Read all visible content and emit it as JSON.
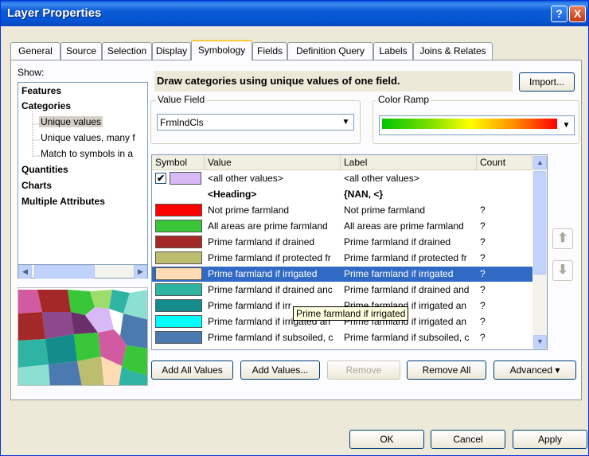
{
  "window": {
    "title": "Layer Properties",
    "help_glyph": "?",
    "close_glyph": "X"
  },
  "tabs": [
    {
      "label": "General"
    },
    {
      "label": "Source"
    },
    {
      "label": "Selection"
    },
    {
      "label": "Display"
    },
    {
      "label": "Symbology",
      "active": true
    },
    {
      "label": "Fields"
    },
    {
      "label": "Definition Query"
    },
    {
      "label": "Labels"
    },
    {
      "label": "Joins & Relates"
    }
  ],
  "show": {
    "label": "Show:",
    "items": [
      {
        "label": "Features"
      },
      {
        "label": "Categories"
      },
      {
        "label": "Unique values",
        "selected": true
      },
      {
        "label": "Unique values, many f"
      },
      {
        "label": "Match to symbols in a"
      },
      {
        "label": "Quantities"
      },
      {
        "label": "Charts"
      },
      {
        "label": "Multiple Attributes"
      }
    ]
  },
  "description": "Draw categories using unique values of one field.",
  "import_label": "Import...",
  "value_field": {
    "label": "Value Field",
    "value": "FrmlndCls"
  },
  "color_ramp": {
    "label": "Color Ramp",
    "colors": [
      "#00c400",
      "#ffff00",
      "#ff0000"
    ]
  },
  "table": {
    "headers": {
      "symbol": "Symbol",
      "value": "Value",
      "label": "Label",
      "count": "Count"
    },
    "rows": [
      {
        "color": "#d7b9f5",
        "checkbox": true,
        "value": "<all other values>",
        "label": "<all other values>",
        "count": ""
      },
      {
        "color": "",
        "heading": true,
        "value": "<Heading>",
        "label": "{NAN, <}",
        "count": ""
      },
      {
        "color": "#ff0000",
        "value": "Not prime farmland",
        "label": "Not prime farmland",
        "count": "?"
      },
      {
        "color": "#39c739",
        "value": "All areas are prime farmland",
        "label": "All areas are prime farmland",
        "count": "?"
      },
      {
        "color": "#a52828",
        "value": "Prime farmland if drained",
        "label": "Prime farmland if drained",
        "count": "?"
      },
      {
        "color": "#bdbd70",
        "value": "Prime farmland if protected fr",
        "label": "Prime farmland if protected fr",
        "count": "?"
      },
      {
        "color": "#ffdcb4",
        "selected": true,
        "value": "Prime farmland if irrigated",
        "label": "Prime farmland if irrigated",
        "count": "?"
      },
      {
        "color": "#2fb4a4",
        "value": "Prime farmland if drained anc",
        "label": "Prime farmland if drained and",
        "count": "?"
      },
      {
        "color": "#148c8c",
        "value": "Prime farmland if irr",
        "label": "Prime farmland if irrigated an",
        "count": "?"
      },
      {
        "color": "#00ffff",
        "value": "Prime farmland if irrigated an",
        "label": "Prime farmland if irrigated an",
        "count": "?"
      },
      {
        "color": "#4b7ab0",
        "value": "Prime farmland if subsoiled, c",
        "label": "Prime farmland if subsoiled, c",
        "count": "?"
      }
    ],
    "tooltip": "Prime farmland if irrigated"
  },
  "buttons": {
    "add_all": "Add All Values",
    "add": "Add Values...",
    "remove": "Remove",
    "remove_all": "Remove All",
    "advanced": "Advanced ▾",
    "ok": "OK",
    "cancel": "Cancel",
    "apply": "Apply"
  }
}
